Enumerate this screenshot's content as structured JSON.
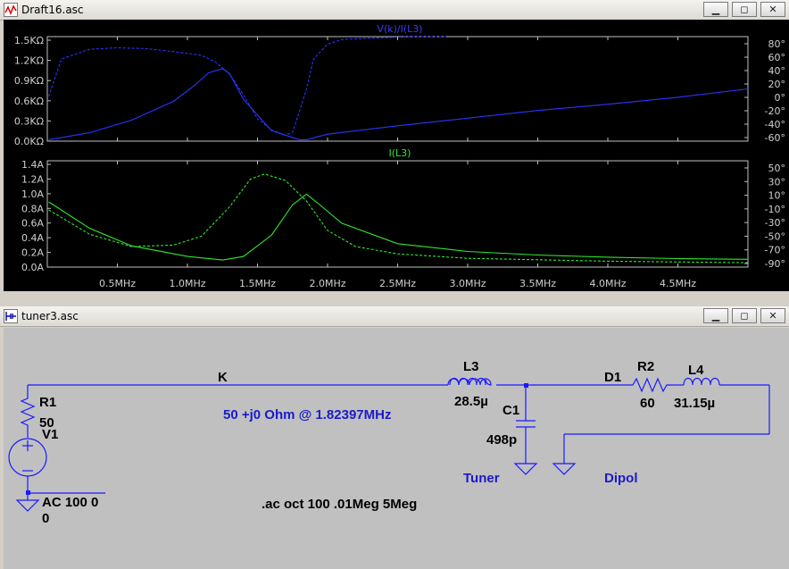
{
  "plot_window": {
    "title": "Draft16.asc",
    "buttons": {
      "minimize": "▁",
      "restore": "◻",
      "close": "✕"
    },
    "top_pane": {
      "trace_label": "V(k)/I(L3)",
      "y_left_ticks": [
        "1.5KΩ",
        "1.2KΩ",
        "0.9KΩ",
        "0.6KΩ",
        "0.3KΩ",
        "0.0KΩ"
      ],
      "y_right_ticks": [
        "80°",
        "60°",
        "40°",
        "20°",
        "0°",
        "-20°",
        "-40°",
        "-60°"
      ]
    },
    "bottom_pane": {
      "trace_label": "I(L3)",
      "y_left_ticks": [
        "1.4A",
        "1.2A",
        "1.0A",
        "0.8A",
        "0.6A",
        "0.4A",
        "0.2A",
        "0.0A"
      ],
      "y_right_ticks": [
        "50°",
        "30°",
        "10°",
        "-10°",
        "-30°",
        "-50°",
        "-70°",
        "-90°"
      ]
    },
    "x_ticks": [
      "0.5MHz",
      "1.0MHz",
      "1.5MHz",
      "2.0MHz",
      "2.5MHz",
      "3.0MHz",
      "3.5MHz",
      "4.0MHz",
      "4.5MHz"
    ]
  },
  "chart_data": [
    {
      "type": "line",
      "title": "V(k)/I(L3)",
      "x_units": "MHz",
      "xlim": [
        0,
        5
      ],
      "ylim": [
        0,
        1.5
      ],
      "ylabel_units": "KΩ",
      "y2lim": [
        -60,
        80
      ],
      "y2_units": "°",
      "color": "#2b35ff",
      "series": [
        {
          "axis": "left",
          "style": "solid",
          "x": [
            0.01,
            0.3,
            0.6,
            0.9,
            1.05,
            1.15,
            1.25,
            1.3,
            1.4,
            1.6,
            1.8,
            1.85,
            2.0,
            2.5,
            3.0,
            3.5,
            4.0,
            4.5,
            5.0
          ],
          "y": [
            0.02,
            0.12,
            0.3,
            0.57,
            0.8,
            0.98,
            1.04,
            0.97,
            0.6,
            0.15,
            0.02,
            0.02,
            0.1,
            0.22,
            0.33,
            0.44,
            0.53,
            0.63,
            0.75
          ]
        },
        {
          "axis": "right",
          "style": "dashed",
          "x": [
            0.01,
            0.1,
            0.3,
            0.5,
            0.7,
            0.9,
            1.1,
            1.2,
            1.3,
            1.4,
            1.5,
            1.6,
            1.7,
            1.75,
            1.8,
            1.85,
            1.9,
            2.0,
            2.1,
            2.3,
            2.6,
            2.85
          ],
          "y": [
            0,
            50,
            63,
            65,
            64,
            60,
            55,
            46,
            30,
            2,
            -30,
            -45,
            -52,
            -48,
            -20,
            10,
            50,
            70,
            76,
            78,
            80,
            80
          ]
        }
      ]
    },
    {
      "type": "line",
      "title": "I(L3)",
      "x_units": "MHz",
      "xlim": [
        0,
        5
      ],
      "ylim": [
        0,
        1.5
      ],
      "ylabel_units": "A",
      "y2lim": [
        -90,
        55
      ],
      "y2_units": "°",
      "color": "#2fe82f",
      "series": [
        {
          "axis": "left",
          "style": "solid",
          "x": [
            0.01,
            0.3,
            0.6,
            1.0,
            1.25,
            1.4,
            1.6,
            1.75,
            1.85,
            1.95,
            2.1,
            2.5,
            3.0,
            3.5,
            4.0,
            4.5,
            5.0
          ],
          "y": [
            0.92,
            0.55,
            0.3,
            0.15,
            0.1,
            0.15,
            0.45,
            0.88,
            1.03,
            0.87,
            0.62,
            0.33,
            0.22,
            0.17,
            0.14,
            0.12,
            0.11
          ]
        },
        {
          "axis": "right",
          "style": "dashed",
          "x": [
            0.01,
            0.3,
            0.6,
            0.9,
            1.1,
            1.3,
            1.45,
            1.55,
            1.7,
            1.85,
            2.0,
            2.2,
            2.5,
            3.0,
            3.5,
            4.0,
            4.5,
            5.0
          ],
          "y": [
            -12,
            -45,
            -62,
            -60,
            -48,
            -8,
            30,
            37,
            28,
            0,
            -40,
            -62,
            -72,
            -78,
            -80,
            -82,
            -83,
            -84
          ]
        }
      ]
    }
  ],
  "schematic_window": {
    "title": "tuner3.asc",
    "buttons": {
      "minimize": "▁",
      "restore": "◻",
      "close": "✕"
    },
    "labels": {
      "net_k": "K",
      "net_d1": "D1",
      "r1_name": "R1",
      "r1_value": "50",
      "v1_name": "V1",
      "v1_ac": "AC 100 0",
      "v1_dc": "0",
      "l3_name": "L3",
      "l3_value": "28.5µ",
      "c1_name": "C1",
      "c1_value": "498p",
      "r2_name": "R2",
      "r2_value": "60",
      "l4_name": "L4",
      "l4_value": "31.15µ",
      "impedance_note": "50 +j0 Ohm @ 1.82397MHz",
      "tuner_label": "Tuner",
      "dipol_label": "Dipol",
      "sim_directive": ".ac oct 100 .01Meg 5Meg"
    }
  }
}
